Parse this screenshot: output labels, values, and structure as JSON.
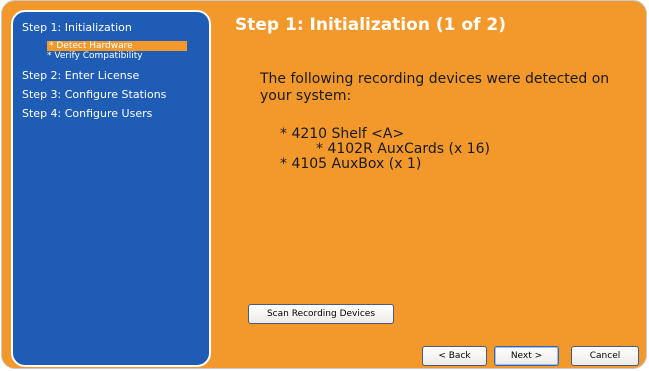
{
  "sidebar": {
    "steps": [
      {
        "label": "Step 1: Initialization"
      },
      {
        "label": "Step 2: Enter License"
      },
      {
        "label": "Step 3: Configure Stations"
      },
      {
        "label": "Step 4: Configure Users"
      }
    ],
    "substeps": [
      {
        "label": "* Detect Hardware",
        "active": true
      },
      {
        "label": "* Verify Compatibility",
        "active": false
      }
    ]
  },
  "main": {
    "title": "Step 1: Initialization (1 of 2)",
    "intro": "The following recording devices were detected on your system:",
    "devices": [
      {
        "label": "* 4210 Shelf <A>"
      },
      {
        "label": "* 4102R AuxCards (x 16)"
      },
      {
        "label": "* 4105 AuxBox (x 1)"
      }
    ]
  },
  "buttons": {
    "scan": "Scan Recording Devices",
    "back": "< Back",
    "next": "Next >",
    "cancel": "Cancel"
  },
  "colors": {
    "accent_orange": "#f3982b",
    "sidebar_blue": "#1f5cb5"
  }
}
